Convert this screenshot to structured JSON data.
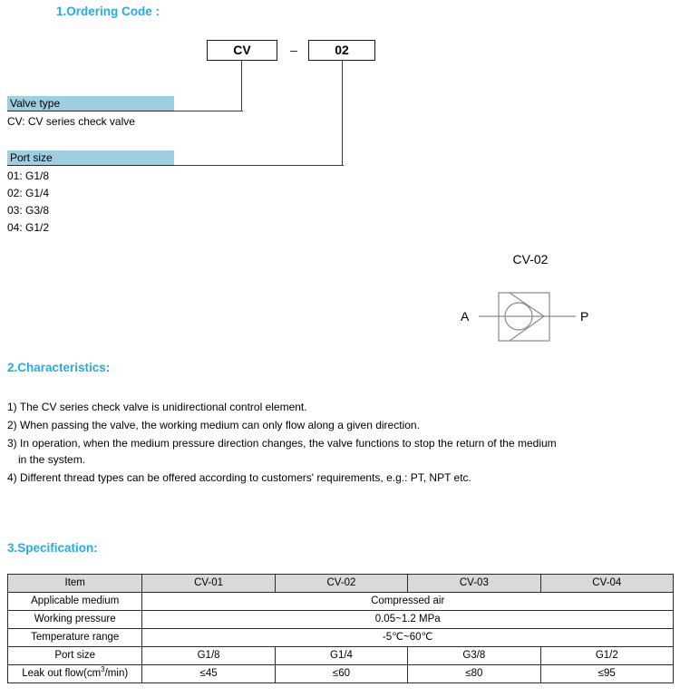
{
  "headings": {
    "ordering": "1.Ordering Code :",
    "characteristics": "2.Characteristics:",
    "specification": "3.Specification:"
  },
  "ordering_code": {
    "series_code": "CV",
    "separator": "–",
    "port_code": "02",
    "valve_type": {
      "bar_label": "Valve type",
      "options": [
        "CV: CV series check valve"
      ]
    },
    "port_size": {
      "bar_label": "Port size",
      "options": [
        "01: G1/8",
        "02: G1/4",
        "03: G3/8",
        "04: G1/2"
      ]
    }
  },
  "symbol": {
    "title": "CV-02",
    "port_in_label": "A",
    "port_out_label": "P"
  },
  "characteristics": {
    "items": [
      "1) The CV series check valve is unidirectional control element.",
      "2) When passing the valve, the working medium can only flow along a given direction.",
      "3) In operation, when the medium pressure direction changes, the valve functions to stop the return of the medium",
      "in the system.",
      "4) Different thread types can be offered according to customers' requirements, e.g.: PT, NPT etc."
    ]
  },
  "specification": {
    "headers": [
      "Item",
      "CV-01",
      "CV-02",
      "CV-03",
      "CV-04"
    ],
    "rows": [
      {
        "item": "Applicable medium",
        "span_value": "Compressed air"
      },
      {
        "item": "Working pressure",
        "span_value": "0.05~1.2 MPa"
      },
      {
        "item": "Temperature range",
        "span_value": "-5℃~60℃"
      },
      {
        "item": "Port size",
        "values": [
          "G1/8",
          "G1/4",
          "G3/8",
          "G1/2"
        ]
      },
      {
        "item": "Leak out flow(cm",
        "item_sup": "3",
        "item_tail": "/min)",
        "values": [
          "≤45",
          "≤60",
          "≤80",
          "≤95"
        ]
      }
    ]
  },
  "colors": {
    "heading_blue": "#29abe2",
    "bar_blue": "#9dcfe0",
    "table_header_gray": "#d9d9d9",
    "line_black": "#2b2b2b"
  }
}
